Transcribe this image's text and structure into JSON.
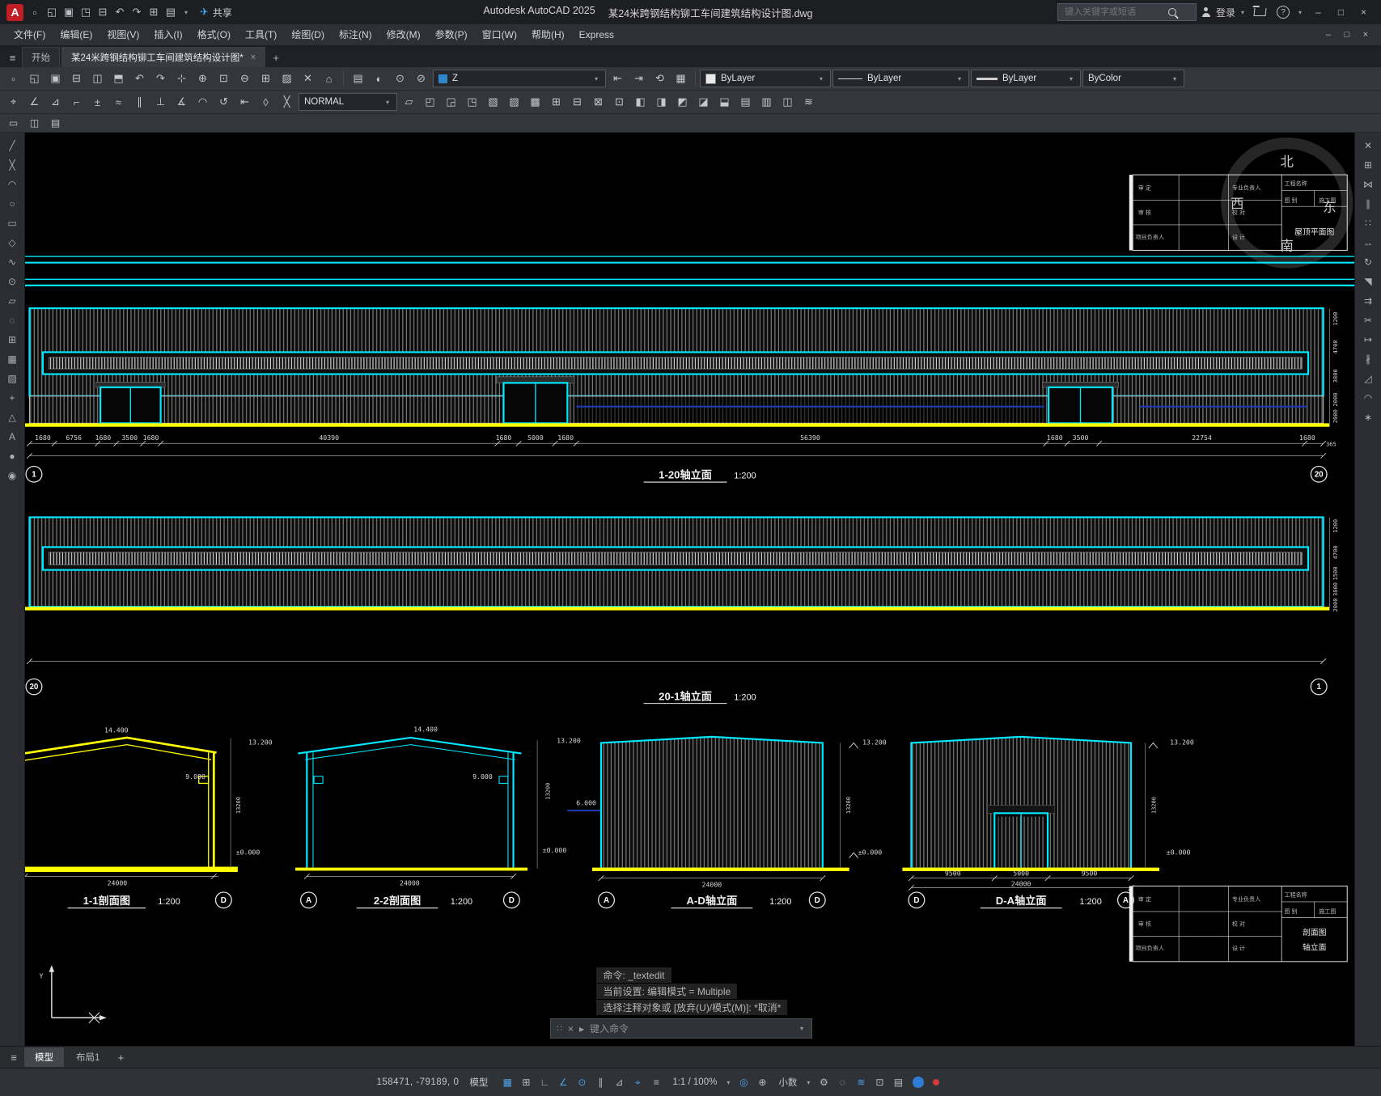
{
  "icons": {
    "close": "×",
    "plus": "+",
    "caret": "▾",
    "menu": "≡",
    "share": "✈",
    "help": "?",
    "prompt": "▸",
    "grip": "∷",
    "logo": "A"
  },
  "titlebar": {
    "app_title": "Autodesk AutoCAD 2025",
    "doc_title": "某24米跨钢结构铆工车间建筑结构设计图.dwg",
    "share_label": "共享",
    "search_placeholder": "键入关键字或短语",
    "login_label": "登录",
    "qat": [
      {
        "name": "new-file-icon",
        "glyph": "▫"
      },
      {
        "name": "open-file-icon",
        "glyph": "◱"
      },
      {
        "name": "save-icon",
        "glyph": "▣"
      },
      {
        "name": "save-as-icon",
        "glyph": "◳"
      },
      {
        "name": "plot-icon",
        "glyph": "⊟"
      },
      {
        "name": "undo-icon",
        "glyph": "↶"
      },
      {
        "name": "redo-icon",
        "glyph": "↷"
      },
      {
        "name": "batch-plot-icon",
        "glyph": "⊞"
      },
      {
        "name": "properties-icon",
        "glyph": "▤"
      }
    ],
    "window_icons": [
      {
        "name": "minimize-icon",
        "glyph": "–"
      },
      {
        "name": "maximize-icon",
        "glyph": "□"
      },
      {
        "name": "close-icon",
        "glyph": "×"
      }
    ]
  },
  "menubar": {
    "items": [
      "文件(F)",
      "编辑(E)",
      "视图(V)",
      "插入(I)",
      "格式(O)",
      "工具(T)",
      "绘图(D)",
      "标注(N)",
      "修改(M)",
      "参数(P)",
      "窗口(W)",
      "帮助(H)",
      "Express"
    ],
    "doc_window_icons": [
      {
        "name": "doc-minimize-icon",
        "glyph": "–"
      },
      {
        "name": "doc-restore-icon",
        "glyph": "□"
      },
      {
        "name": "doc-close-icon",
        "glyph": "×"
      }
    ]
  },
  "tabbar": {
    "start_tab": "开始",
    "doc_tab": "某24米跨钢结构铆工车间建筑结构设计图*"
  },
  "toolbar": {
    "layer_value": "Z",
    "color_value": "ByLayer",
    "linetype_value": "ByLayer",
    "lineweight_value": "ByLayer",
    "plotstyle_value": "ByColor",
    "textstyle_value": "NORMAL"
  },
  "toolbars": {
    "row1_icons": [
      {
        "name": "new-icon",
        "glyph": "▫"
      },
      {
        "name": "open-icon",
        "glyph": "◱"
      },
      {
        "name": "save-icon",
        "glyph": "▣"
      },
      {
        "name": "plot-icon",
        "glyph": "⊟"
      },
      {
        "name": "plot-preview-icon",
        "glyph": "◫"
      },
      {
        "name": "publish-icon",
        "glyph": "⬒"
      },
      {
        "name": "undo-icon",
        "glyph": "↶"
      },
      {
        "name": "redo-icon",
        "glyph": "↷"
      },
      {
        "name": "pan-icon",
        "glyph": "⊹"
      },
      {
        "name": "zoom-realtime-icon",
        "glyph": "⊕"
      },
      {
        "name": "zoom-window-icon",
        "glyph": "⊡"
      },
      {
        "name": "zoom-previous-icon",
        "glyph": "⊖"
      },
      {
        "name": "copy-clip-icon",
        "glyph": "⊞"
      },
      {
        "name": "match-properties-icon",
        "glyph": "▨"
      },
      {
        "name": "erase-icon",
        "glyph": "✕"
      },
      {
        "name": "sheet-set-icon",
        "glyph": "⌂"
      }
    ],
    "row1_layer_icons": [
      {
        "name": "layer-properties-icon",
        "glyph": "▤"
      },
      {
        "name": "layer-off-icon",
        "glyph": "◐"
      },
      {
        "name": "layer-isolate-icon",
        "glyph": "⊙"
      },
      {
        "name": "layer-lock-icon",
        "glyph": "⊘"
      }
    ],
    "row1_layer_icons2": [
      {
        "name": "layer-previous-icon",
        "glyph": "⇤"
      },
      {
        "name": "layer-next-icon",
        "glyph": "⇥"
      },
      {
        "name": "layer-state-icon",
        "glyph": "⟲"
      },
      {
        "name": "layer-walk-icon",
        "glyph": "▦"
      }
    ],
    "row2_icons_a": [
      {
        "name": "dim-linear-icon",
        "glyph": "⌖"
      },
      {
        "name": "dim-angular-icon",
        "glyph": "∠"
      },
      {
        "name": "dim-radius-icon",
        "glyph": "⊿"
      },
      {
        "name": "dim-baseline-icon",
        "glyph": "⌐"
      },
      {
        "name": "tolerance-icon",
        "glyph": "±"
      },
      {
        "name": "dim-continue-icon",
        "glyph": "≈"
      },
      {
        "name": "parallel-icon",
        "glyph": "∥"
      },
      {
        "name": "perpendicular-icon",
        "glyph": "⊥"
      },
      {
        "name": "dim-arc-icon",
        "glyph": "∡"
      },
      {
        "name": "arc-icon",
        "glyph": "◠"
      },
      {
        "name": "dim-update-icon",
        "glyph": "↺"
      },
      {
        "name": "dim-left-icon",
        "glyph": "⇤"
      },
      {
        "name": "diamond-icon",
        "glyph": "◊"
      },
      {
        "name": "cross-icon",
        "glyph": "╳"
      }
    ],
    "row2_icons_b": [
      {
        "name": "table-icon",
        "glyph": "▱"
      },
      {
        "name": "block-icon",
        "glyph": "◰"
      },
      {
        "name": "wblock-icon",
        "glyph": "◲"
      },
      {
        "name": "attach-icon",
        "glyph": "◳"
      },
      {
        "name": "clip-icon",
        "glyph": "▧"
      },
      {
        "name": "hatch-edit-icon",
        "glyph": "▨"
      },
      {
        "name": "boundary-icon",
        "glyph": "▩"
      },
      {
        "name": "group-icon",
        "glyph": "⊞"
      },
      {
        "name": "ungroup-icon",
        "glyph": "⊟"
      },
      {
        "name": "region-icon",
        "glyph": "⊠"
      },
      {
        "name": "viewport-icon",
        "glyph": "⊡"
      },
      {
        "name": "left-view-icon",
        "glyph": "◧"
      },
      {
        "name": "right-view-icon",
        "glyph": "◨"
      },
      {
        "name": "top-view-icon",
        "glyph": "◩"
      },
      {
        "name": "bottom-view-icon",
        "glyph": "◪"
      },
      {
        "name": "shade-icon",
        "glyph": "⬓"
      },
      {
        "name": "style-icon",
        "glyph": "▤"
      },
      {
        "name": "text-style-icon",
        "glyph": "▥"
      },
      {
        "name": "dim-style-icon",
        "glyph": "◫"
      },
      {
        "name": "multileader-icon",
        "glyph": "≋"
      }
    ],
    "row3_icons": [
      {
        "name": "block-editor-icon",
        "glyph": "▭"
      },
      {
        "name": "xref-icon",
        "glyph": "◫"
      },
      {
        "name": "image-icon",
        "glyph": "▤"
      }
    ],
    "left_tools": [
      {
        "name": "line-icon",
        "glyph": "╱"
      },
      {
        "name": "construction-line-icon",
        "glyph": "╳"
      },
      {
        "name": "arc-icon",
        "glyph": "◠"
      },
      {
        "name": "circle-icon",
        "glyph": "○"
      },
      {
        "name": "rectangle-icon",
        "glyph": "▭"
      },
      {
        "name": "polygon-icon",
        "glyph": "◇"
      },
      {
        "name": "spline-icon",
        "glyph": "∿"
      },
      {
        "name": "donut-icon",
        "glyph": "⊙"
      },
      {
        "name": "ellipse-icon",
        "glyph": "▱"
      },
      {
        "name": "revision-cloud-icon",
        "glyph": "◌"
      },
      {
        "name": "insert-block-icon",
        "glyph": "⊞"
      },
      {
        "name": "hatch-icon",
        "glyph": "▦"
      },
      {
        "name": "gradient-icon",
        "glyph": "▨"
      },
      {
        "name": "point-icon",
        "glyph": "+"
      },
      {
        "name": "region-icon",
        "glyph": "△"
      },
      {
        "name": "text-icon",
        "glyph": "A"
      },
      {
        "name": "point-style-icon",
        "glyph": "●"
      },
      {
        "name": "wipeout-icon",
        "glyph": "◉"
      }
    ],
    "right_tools": [
      {
        "name": "erase-icon",
        "glyph": "✕"
      },
      {
        "name": "copy-icon",
        "glyph": "⊞"
      },
      {
        "name": "mirror-icon",
        "glyph": "⋈"
      },
      {
        "name": "offset-icon",
        "glyph": "∥"
      },
      {
        "name": "array-icon",
        "glyph": "∷"
      },
      {
        "name": "move-icon",
        "glyph": "↔"
      },
      {
        "name": "rotate-icon",
        "glyph": "↻"
      },
      {
        "name": "scale-icon",
        "glyph": "◥"
      },
      {
        "name": "stretch-icon",
        "glyph": "⇉"
      },
      {
        "name": "trim-icon",
        "glyph": "✂"
      },
      {
        "name": "extend-icon",
        "glyph": "↦"
      },
      {
        "name": "break-icon",
        "glyph": "∦"
      },
      {
        "name": "chamfer-icon",
        "glyph": "◿"
      },
      {
        "name": "fillet-icon",
        "glyph": "◠"
      },
      {
        "name": "explode-icon",
        "glyph": "∗"
      }
    ]
  },
  "drawing": {
    "elev1": {
      "label": "1-20轴立面",
      "scale": "1:200",
      "axis_left": "1",
      "axis_right": "20",
      "dims": [
        "1680",
        "6756",
        "1680",
        "3500",
        "1680",
        "40390",
        "1680",
        "5000",
        "1680",
        "56390",
        "1680",
        "3500",
        "22754",
        "1680"
      ],
      "vdims": [
        "1200",
        "4700",
        "3800",
        "2000",
        "2000"
      ],
      "end_dim": "365"
    },
    "elev2": {
      "label": "20-1轴立面",
      "scale": "1:200",
      "axis_left": "20",
      "axis_right": "1",
      "vdims": [
        "1200",
        "4700",
        "1500",
        "3800",
        "2000"
      ]
    },
    "sections": [
      {
        "label": "1-1剖面图",
        "scale": "1:200",
        "peak": "14.400",
        "eave": "13.200",
        "mid": "9.000",
        "base": "±0.000",
        "width": "24000",
        "height_dim": "13200",
        "axis_right": "D"
      },
      {
        "label": "2-2剖面图",
        "scale": "1:200",
        "peak": "14.400",
        "eave": "13.200",
        "mid": "9.000",
        "level": "6.000",
        "base": "±0.000",
        "width": "24000",
        "height_dim": "13200",
        "axis_left": "A",
        "axis_right": "D"
      },
      {
        "label": "A-D轴立面",
        "scale": "1:200",
        "eave": "13.200",
        "base": "±0.000",
        "width": "24000",
        "height_dim": "13200",
        "axis_left": "A",
        "axis_right": "D"
      },
      {
        "label": "D-A轴立面",
        "scale": "1:200",
        "eave": "13.200",
        "base": "±0.000",
        "w1": "9500",
        "w2": "5000",
        "w3": "9500",
        "width": "24000",
        "height_dim": "13200",
        "axis_left": "D",
        "axis_right": "A"
      }
    ],
    "compass": {
      "n": "北",
      "w": "西",
      "e": "东",
      "s": "南"
    },
    "titleblock": {
      "project_label": "工程名称",
      "sheet_label": "图 别",
      "sheet_value": "施工图",
      "rows_left": [
        "审 定",
        "审 核",
        "项目负责人"
      ],
      "rows_mid": [
        "专业负责人",
        "校 对",
        "设 计"
      ],
      "top_title": "屋顶平面图",
      "bottom_title_1": "剖面图",
      "bottom_title_2": "轴立面"
    },
    "ucs": {
      "y_label": "Y"
    }
  },
  "commandline": {
    "history": [
      "命令: _textedit",
      "当前设置: 编辑模式 = Multiple",
      "选择注释对象或 [放弃(U)/模式(M)]: *取消*"
    ],
    "prompt": "键入命令"
  },
  "layout_tabs": {
    "model": "模型",
    "layout1": "布局1"
  },
  "statusbar": {
    "coords": "158471, -79189, 0",
    "model_label": "模型",
    "zoom": "1:1 / 100%",
    "units": "小数",
    "icons_a": [
      {
        "name": "grid-icon",
        "glyph": "▦",
        "on": true
      },
      {
        "name": "snap-icon",
        "glyph": "⊞"
      },
      {
        "name": "ortho-icon",
        "glyph": "∟"
      },
      {
        "name": "polar-icon",
        "glyph": "∠",
        "on": true
      },
      {
        "name": "osnap-icon",
        "glyph": "⊙",
        "on": true
      },
      {
        "name": "otrack-icon",
        "glyph": "∥"
      },
      {
        "name": "dynamic-ucs-icon",
        "glyph": "⊿"
      },
      {
        "name": "dynamic-input-icon",
        "glyph": "⌖",
        "on": true
      },
      {
        "name": "lineweight-icon",
        "glyph": "≡"
      }
    ],
    "icons_b": [
      {
        "name": "annotation-visibility-icon",
        "glyph": "◎",
        "on": true
      },
      {
        "name": "autoscale-icon",
        "glyph": "⊕"
      }
    ],
    "icons_c": [
      {
        "name": "workspace-icon",
        "glyph": "⚙"
      },
      {
        "name": "annotation-monitor-icon",
        "glyph": "◌"
      },
      {
        "name": "graphics-performance-icon",
        "glyph": "≋",
        "on": true
      },
      {
        "name": "clean-screen-icon",
        "glyph": "⊡"
      },
      {
        "name": "customization-icon",
        "glyph": "▤"
      }
    ]
  }
}
